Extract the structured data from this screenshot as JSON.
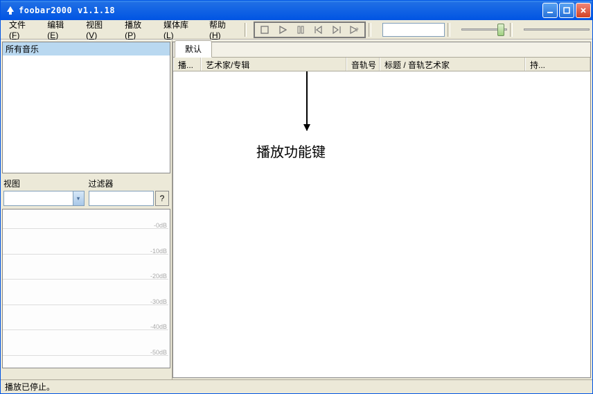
{
  "window": {
    "title": "foobar2000 v1.1.18"
  },
  "menu": {
    "file": {
      "label": "文件",
      "key": "F"
    },
    "edit": {
      "label": "编辑",
      "key": "E"
    },
    "view": {
      "label": "视图",
      "key": "V"
    },
    "play": {
      "label": "播放",
      "key": "P"
    },
    "library": {
      "label": "媒体库",
      "key": "L"
    },
    "help": {
      "label": "帮助",
      "key": "H"
    }
  },
  "sidebar": {
    "all_music": "所有音乐",
    "view_label": "视图",
    "filter_label": "过滤器",
    "help_btn": "?"
  },
  "vis": {
    "ticks": [
      "-0dB",
      "-10dB",
      "-20dB",
      "-30dB",
      "-40dB",
      "-50dB"
    ]
  },
  "playlist": {
    "tab": "默认",
    "columns": {
      "playing": "播...",
      "artist_album": "艺术家/专辑",
      "trackno": "音轨号",
      "title": "标题 / 音轨艺术家",
      "duration": "持..."
    }
  },
  "annotation": "播放功能键",
  "status": "播放已停止。"
}
